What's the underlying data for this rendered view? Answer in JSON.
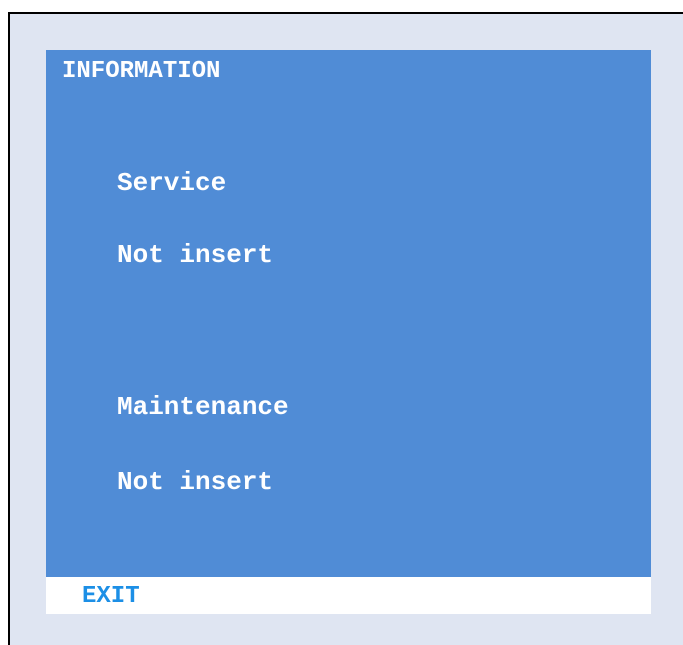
{
  "panel": {
    "title": "INFORMATION",
    "service": {
      "label": "Service",
      "status": "Not insert"
    },
    "maintenance": {
      "label": "Maintenance",
      "status": "Not insert"
    }
  },
  "footer": {
    "exit_label": "EXIT"
  },
  "colors": {
    "background": "#dfe5f2",
    "panel": "#508cd6",
    "text": "#ffffff",
    "exit_text": "#1c8fe6"
  }
}
